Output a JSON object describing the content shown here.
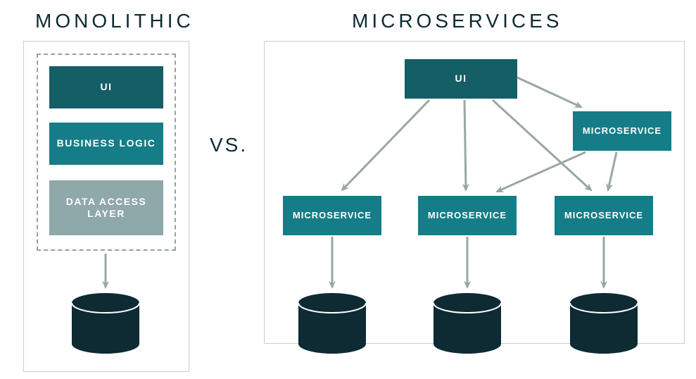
{
  "titles": {
    "monolithic": "MONOLITHIC",
    "microservices": "MICROSERVICES"
  },
  "vs": "VS.",
  "monolith": {
    "ui": "UI",
    "business": "BUSINESS LOGIC",
    "data": "DATA ACCESS LAYER"
  },
  "micro": {
    "ui": "UI",
    "right": "MICROSERVICE",
    "m1": "MICROSERVICE",
    "m2": "MICROSERVICE",
    "m3": "MICROSERVICE"
  },
  "colors": {
    "darkTeal": "#145e66",
    "teal": "#147d87",
    "grayTeal": "#8fa8aa",
    "dbFill": "#0e2a33",
    "arrow": "#9aa6a7",
    "panelBorder": "#c9cfcc"
  }
}
